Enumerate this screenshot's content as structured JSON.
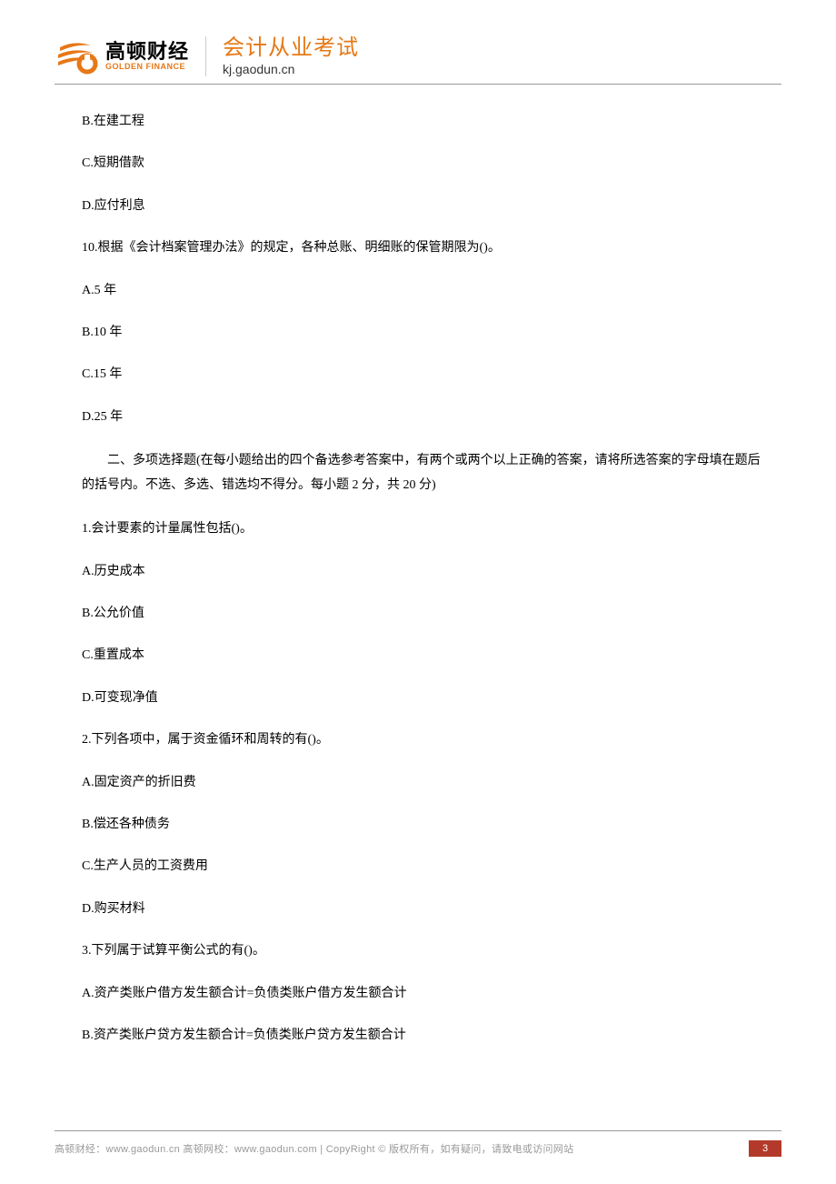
{
  "header": {
    "logo_cn": "高顿财经",
    "logo_en": "GOLDEN FINANCE",
    "exam_cn": "会计从业考试",
    "exam_url": "kj.gaodun.cn"
  },
  "q9_options": {
    "b": "B.在建工程",
    "c": "C.短期借款",
    "d": "D.应付利息"
  },
  "q10": {
    "stem": "10.根据《会计档案管理办法》的规定，各种总账、明细账的保管期限为()。",
    "a": "A.5 年",
    "b": "B.10 年",
    "c": "C.15 年",
    "d": "D.25 年"
  },
  "section2_instr": "二、多项选择题(在每小题给出的四个备选参考答案中，有两个或两个以上正确的答案，请将所选答案的字母填在题后的括号内。不选、多选、错选均不得分。每小题 2 分，共 20 分)",
  "s2q1": {
    "stem": "1.会计要素的计量属性包括()。",
    "a": "A.历史成本",
    "b": "B.公允价值",
    "c": "C.重置成本",
    "d": "D.可变现净值"
  },
  "s2q2": {
    "stem": "2.下列各项中，属于资金循环和周转的有()。",
    "a": "A.固定资产的折旧费",
    "b": "B.偿还各种债务",
    "c": "C.生产人员的工资费用",
    "d": "D.购买材料"
  },
  "s2q3": {
    "stem": "3.下列属于试算平衡公式的有()。",
    "a": "A.资产类账户借方发生额合计=负债类账户借方发生额合计",
    "b": "B.资产类账户贷方发生额合计=负债类账户贷方发生额合计"
  },
  "footer": {
    "text": "高顿财经：www.gaodun.cn    高顿网校：www.gaodun.com |    CopyRight ©  版权所有，如有疑问，请致电或访问网站",
    "page": "3"
  }
}
